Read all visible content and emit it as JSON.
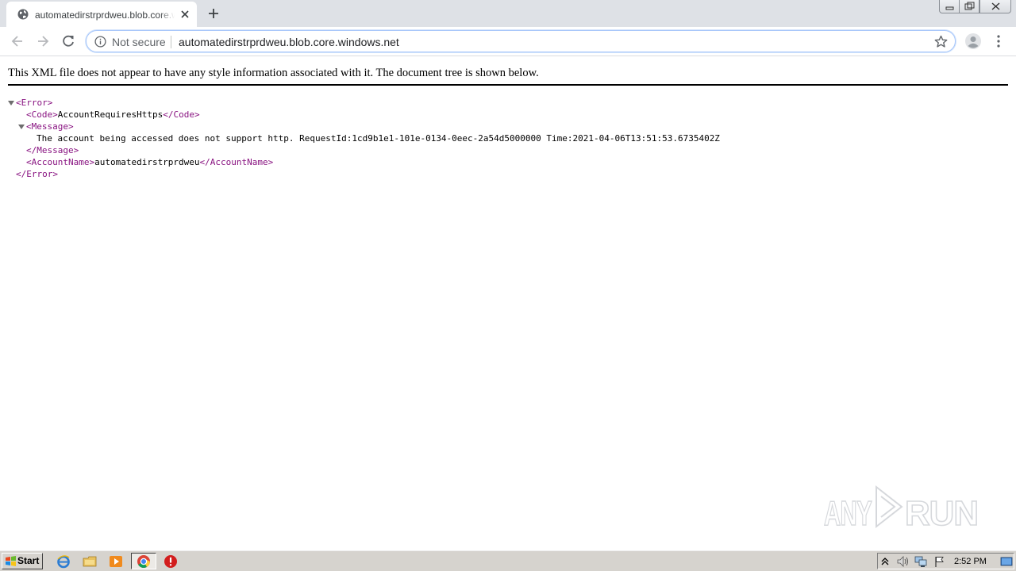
{
  "browser": {
    "tab": {
      "title": "automatedirstrprdweu.blob.core.windows.net"
    },
    "omnibox": {
      "security_label": "Not secure",
      "url": "automatedirstrprdweu.blob.core.windows.net"
    }
  },
  "page": {
    "notice": "This XML file does not appear to have any style information associated with it. The document tree is shown below.",
    "xml": {
      "error_open": "<Error>",
      "error_close": "</Error>",
      "code_open": "<Code>",
      "code_value": "AccountRequiresHttps",
      "code_close": "</Code>",
      "message_open": "<Message>",
      "message_value": "The account being accessed does not support http. RequestId:1cd9b1e1-101e-0134-0eec-2a54d5000000 Time:2021-04-06T13:51:53.6735402Z",
      "message_close": "</Message>",
      "account_open": "<AccountName>",
      "account_value": "automatedirstrprdweu",
      "account_close": "</AccountName>"
    },
    "watermark": "ANY RUN"
  },
  "taskbar": {
    "start_label": "Start",
    "clock": "2:52 PM",
    "pinned": [
      "internet-explorer-icon",
      "file-explorer-icon",
      "media-player-icon",
      "chrome-icon",
      "stop-icon"
    ]
  },
  "colors": {
    "tag": "#881280",
    "tabstrip": "#dee1e6",
    "taskbar": "#d6d3ce"
  }
}
